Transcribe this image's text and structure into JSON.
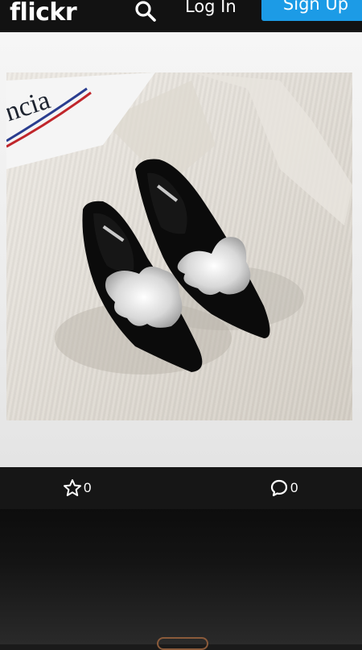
{
  "header": {
    "logo": "flickr",
    "login_label": "Log In",
    "signup_label": "Sign Up",
    "search_icon": "search-icon"
  },
  "photo": {
    "subject": "black pointed mules with crystal embellishment on striped shirt",
    "box_text": "ncia"
  },
  "actions": {
    "favorites_count": "0",
    "comments_count": "0",
    "favorite_icon": "star-icon",
    "comment_icon": "comment-icon"
  },
  "colors": {
    "brand_blue": "#1c9be6",
    "bar_dark": "#161616"
  }
}
